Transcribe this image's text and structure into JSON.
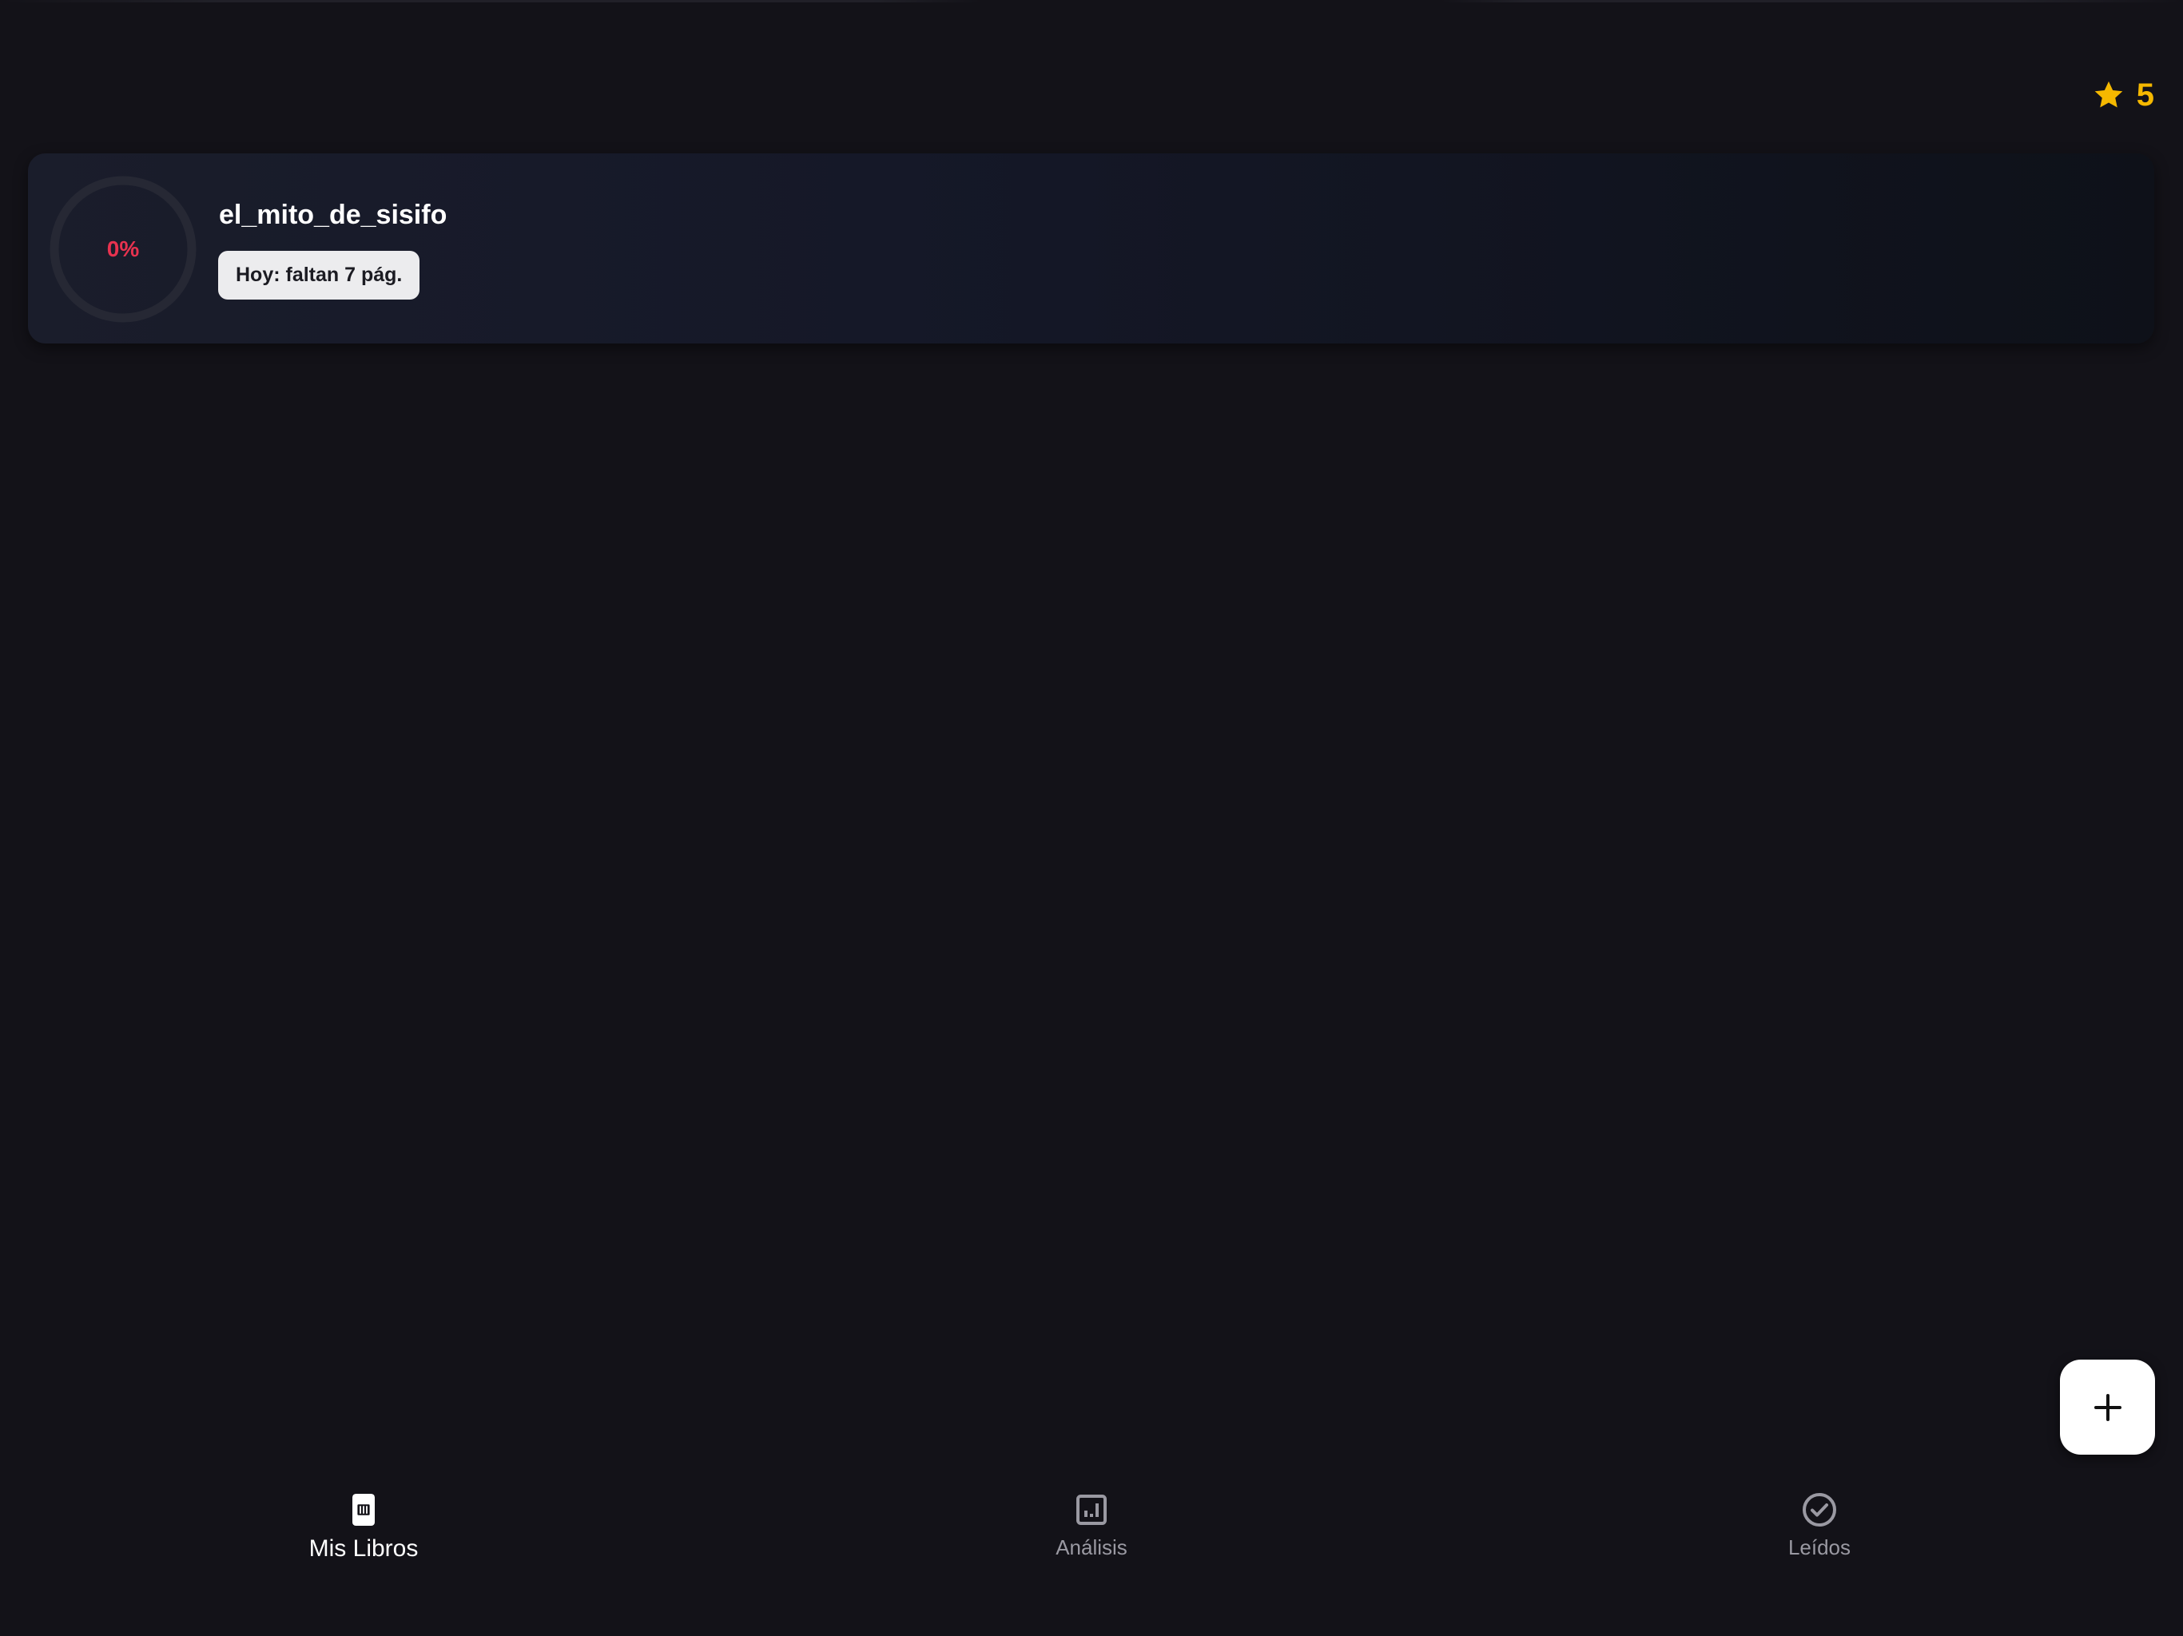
{
  "streak": {
    "count": "5",
    "icon": "star-icon",
    "color": "#f5b800"
  },
  "books": [
    {
      "title": "el_mito_de_sisifo",
      "progress_label": "0%",
      "progress_fraction": 0,
      "today_label": "Hoy: faltan 7 pág.",
      "progress_color": "#e8324f"
    }
  ],
  "fab": {
    "icon": "plus-icon"
  },
  "bottom_nav": {
    "items": [
      {
        "label": "Mis Libros",
        "icon": "book-icon",
        "active": true
      },
      {
        "label": "Análisis",
        "icon": "analytics-icon",
        "active": false
      },
      {
        "label": "Leídos",
        "icon": "check-circle-icon",
        "active": false
      }
    ]
  },
  "colors": {
    "background": "#131218",
    "card_start": "#1a1d2b",
    "card_end": "#0e1119",
    "chip_bg": "#ececee",
    "nav_inactive": "#9a99a2"
  }
}
